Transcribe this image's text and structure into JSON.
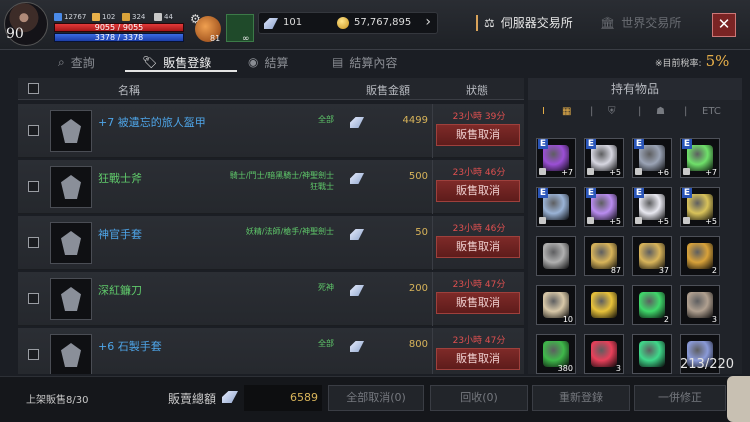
{
  "player": {
    "level": "90",
    "stat1": "12767",
    "stat2": "102",
    "stat3": "324",
    "stat4": "44",
    "hp": "9055 / 9055",
    "mp": "3378 / 3378",
    "potion_count": "81",
    "herb_count": "∞"
  },
  "currency": {
    "gems": "101",
    "gold": "57,767,895"
  },
  "exchange_tabs": {
    "server": "伺服器交易所",
    "world": "世界交易所"
  },
  "close_label": "✕",
  "subtabs": [
    {
      "label": "查詢"
    },
    {
      "label": "販售登錄"
    },
    {
      "label": "結算"
    },
    {
      "label": "結算內容"
    }
  ],
  "tax": {
    "label": "※目前稅率:",
    "value": "5%"
  },
  "list_headers": {
    "name": "名稱",
    "price": "販售金額",
    "status": "狀態"
  },
  "listings": [
    {
      "name": "+7 被遺忘的旅人盔甲",
      "name_color": "#4ea5e8",
      "classes": "全部",
      "price": "4499",
      "timer": "23小時 39分",
      "cancel": "販售取消"
    },
    {
      "name": "狂戰士斧",
      "name_color": "#5fc86a",
      "classes": "騎士/鬥士/暗黑騎士/神聖劍士\n狂戰士",
      "price": "500",
      "timer": "23小時 46分",
      "cancel": "販售取消"
    },
    {
      "name": "神官手套",
      "name_color": "#4ea5e8",
      "classes": "妖精/法師/槍手/神聖劍士",
      "price": "50",
      "timer": "23小時 46分",
      "cancel": "販售取消"
    },
    {
      "name": "深紅鐮刀",
      "name_color": "#5fc86a",
      "classes": "死神",
      "price": "200",
      "timer": "23小時 47分",
      "cancel": "販售取消"
    },
    {
      "name": "+6 石製手套",
      "name_color": "#4ea5e8",
      "classes": "全部",
      "price": "800",
      "timer": "23小時 47分",
      "cancel": "販售取消"
    }
  ],
  "inventory": {
    "title": "持有物品",
    "filters": [
      "I",
      "▦",
      "|",
      "⛨",
      "|",
      "☗",
      "|",
      "ETC"
    ],
    "count": "213/220",
    "slots": [
      {
        "icon": "staff-icon",
        "e": "E",
        "cnt": "+7",
        "color": "#9b4fd6"
      },
      {
        "icon": "armor-icon",
        "e": "E",
        "cnt": "+5",
        "color": "#d6d6e0"
      },
      {
        "icon": "chain-icon",
        "e": "E",
        "cnt": "+6",
        "color": "#9aa3b5"
      },
      {
        "icon": "orb-icon",
        "e": "E",
        "cnt": "+7",
        "color": "#6fe06a"
      },
      {
        "icon": "boots-icon",
        "e": "E",
        "cnt": "",
        "color": "#9ab3d6"
      },
      {
        "icon": "sword-icon",
        "e": "E",
        "cnt": "+5",
        "color": "#b98cf0"
      },
      {
        "icon": "necklace-icon",
        "e": "E",
        "cnt": "+5",
        "color": "#e8e8f0"
      },
      {
        "icon": "gem-cluster-icon",
        "e": "E",
        "cnt": "+5",
        "color": "#d8c25a"
      },
      {
        "icon": "ring-icon",
        "e": "",
        "cnt": "",
        "color": "#b0b0b0"
      },
      {
        "icon": "scroll-icon",
        "e": "",
        "cnt": "87",
        "color": "#d8b45a"
      },
      {
        "icon": "scroll-icon",
        "e": "",
        "cnt": "37",
        "color": "#d8b45a"
      },
      {
        "icon": "scroll-icon",
        "e": "",
        "cnt": "2",
        "color": "#d8a23a"
      },
      {
        "icon": "shell-icon",
        "e": "",
        "cnt": "10",
        "color": "#d8c8a8"
      },
      {
        "icon": "scroll-icon",
        "e": "",
        "cnt": "",
        "color": "#e8c23a"
      },
      {
        "icon": "emerald-icon",
        "e": "",
        "cnt": "2",
        "color": "#3fd86a"
      },
      {
        "icon": "shard-icon",
        "e": "",
        "cnt": "3",
        "color": "#b0a090"
      },
      {
        "icon": "leaf-icon",
        "e": "",
        "cnt": "380",
        "color": "#3fb84a"
      },
      {
        "icon": "crystal-icon",
        "e": "",
        "cnt": "3",
        "color": "#e8405a"
      },
      {
        "icon": "pearl-icon",
        "e": "",
        "cnt": "",
        "color": "#3fd88a"
      },
      {
        "icon": "stone-icon",
        "e": "",
        "cnt": "",
        "color": "#8a9ad8"
      }
    ]
  },
  "footer": {
    "count": "上架販售8/30",
    "total_label": "販賣總額",
    "total_value": "6589",
    "buttons": [
      "全部取消(0)",
      "回收(0)",
      "重新登錄",
      "一併修正"
    ]
  }
}
